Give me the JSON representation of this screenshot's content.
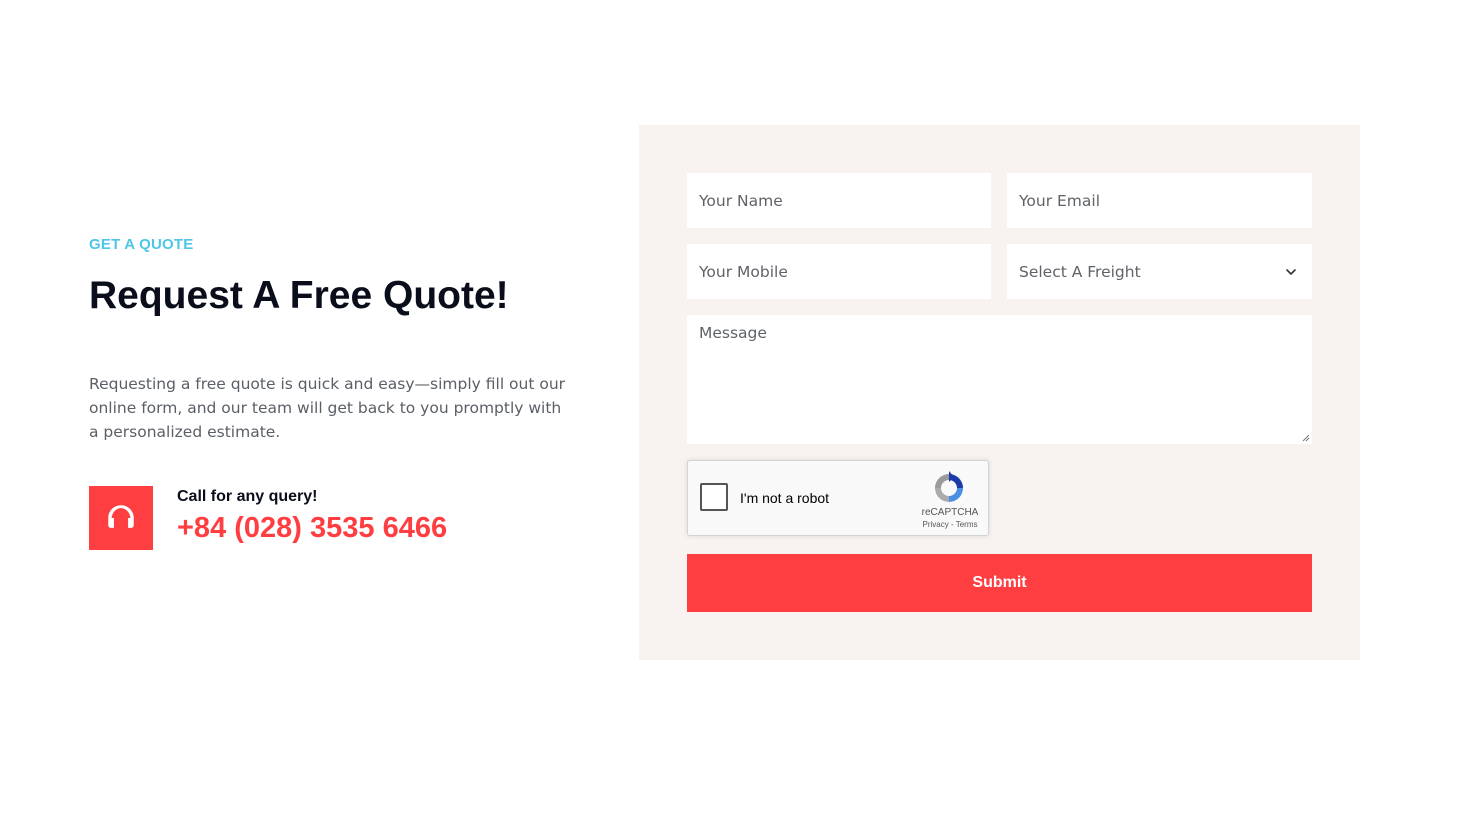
{
  "quote_section": {
    "eyebrow": "GET A QUOTE",
    "title": "Request A Free Quote!",
    "description": "Requesting a free quote is quick and easy—simply fill out our online form, and our team will get back to you promptly with a personalized estimate.",
    "contact": {
      "icon": "headphones-icon",
      "label": "Call for any query!",
      "phone": "+84 (028) 3535 6466"
    }
  },
  "form": {
    "name_placeholder": "Your Name",
    "email_placeholder": "Your Email",
    "mobile_placeholder": "Your Mobile",
    "freight_select_value": "Select A Freight",
    "message_placeholder": "Message",
    "captcha": {
      "label": "I'm not a robot",
      "brand": "reCAPTCHA",
      "links": "Privacy - Terms"
    },
    "submit_label": "Submit"
  },
  "colors": {
    "accent": "#ff3e41",
    "eyebrow": "#4fc6e4",
    "panel_bg": "#f8f2f0",
    "heading": "#0a0d1a"
  }
}
